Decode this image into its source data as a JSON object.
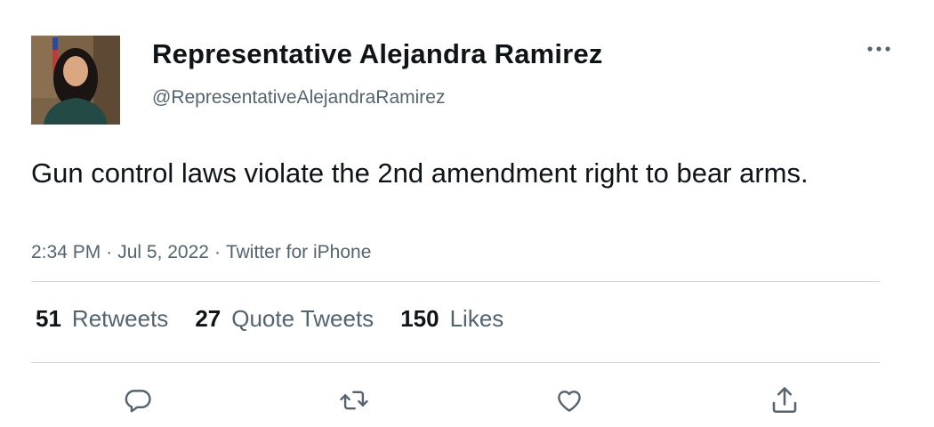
{
  "author": {
    "display_name": "Representative Alejandra Ramirez",
    "handle": "@RepresentativeAlejandraRamirez"
  },
  "tweet": {
    "text": "Gun control laws violate the 2nd amendment right to bear arms.",
    "time": "2:34 PM",
    "date": "Jul 5, 2022",
    "source": "Twitter for iPhone",
    "separator": "·"
  },
  "stats": {
    "retweets": {
      "count": "51",
      "label": "Retweets"
    },
    "quote_tweets": {
      "count": "27",
      "label": "Quote Tweets"
    },
    "likes": {
      "count": "150",
      "label": "Likes"
    }
  },
  "icons": {
    "more": "more-horizontal-icon",
    "reply": "reply-bubble-icon",
    "retweet": "retweet-icon",
    "like": "heart-icon",
    "share": "share-icon"
  },
  "colors": {
    "text_primary": "#0f1419",
    "text_secondary": "#536471",
    "divider": "#cfd9de"
  }
}
